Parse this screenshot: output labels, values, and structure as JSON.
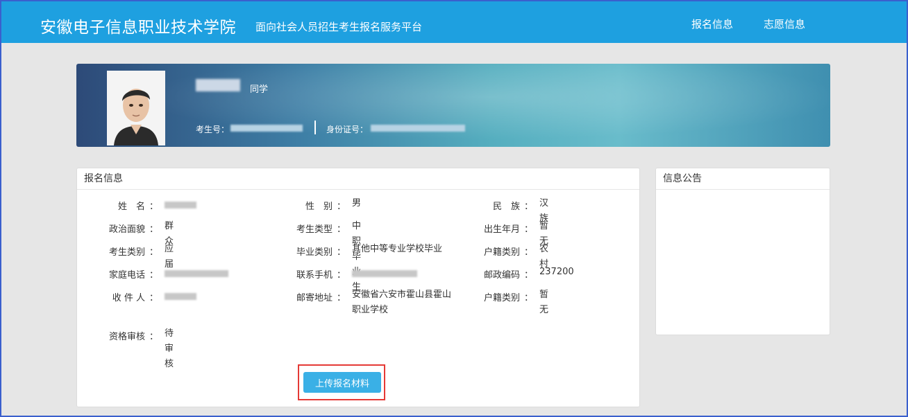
{
  "header": {
    "title": "安徽电子信息职业技术学院",
    "subtitle": "面向社会人员招生考生报名服务平台",
    "nav": [
      "报名信息",
      "志愿信息"
    ]
  },
  "profile": {
    "name_suffix": "同学",
    "exam_no_label": "考生号：",
    "id_no_label": "身份证号："
  },
  "registration": {
    "title": "报名信息",
    "fields": {
      "name": {
        "label": "姓　名",
        "value": ""
      },
      "gender": {
        "label": "性　别",
        "value": "男"
      },
      "ethnicity": {
        "label": "民　族",
        "value": "汉族"
      },
      "political": {
        "label": "政治面貌",
        "value": "群众"
      },
      "candidate_type": {
        "label": "考生类型",
        "value": "中职毕业生"
      },
      "birth": {
        "label": "出生年月",
        "value": "暂无"
      },
      "candidate_category": {
        "label": "考生类别",
        "value": "应届"
      },
      "grad_category": {
        "label": "毕业类别",
        "value": "其他中等专业学校毕业"
      },
      "household": {
        "label": "户籍类别",
        "value": "农村"
      },
      "home_phone": {
        "label": "家庭电话",
        "value": ""
      },
      "mobile": {
        "label": "联系手机",
        "value": ""
      },
      "postcode": {
        "label": "邮政编码",
        "value": "237200"
      },
      "recipient": {
        "label": "收 件 人",
        "value": ""
      },
      "address": {
        "label": "邮寄地址",
        "value": "安徽省六安市霍山县霍山职业学校"
      },
      "household2": {
        "label": "户籍类别",
        "value": "暂无"
      },
      "review": {
        "label": "资格审核",
        "value": "待审核"
      }
    },
    "colon": "：",
    "upload_label": "上传报名材料"
  },
  "announcement": {
    "title": "信息公告"
  }
}
